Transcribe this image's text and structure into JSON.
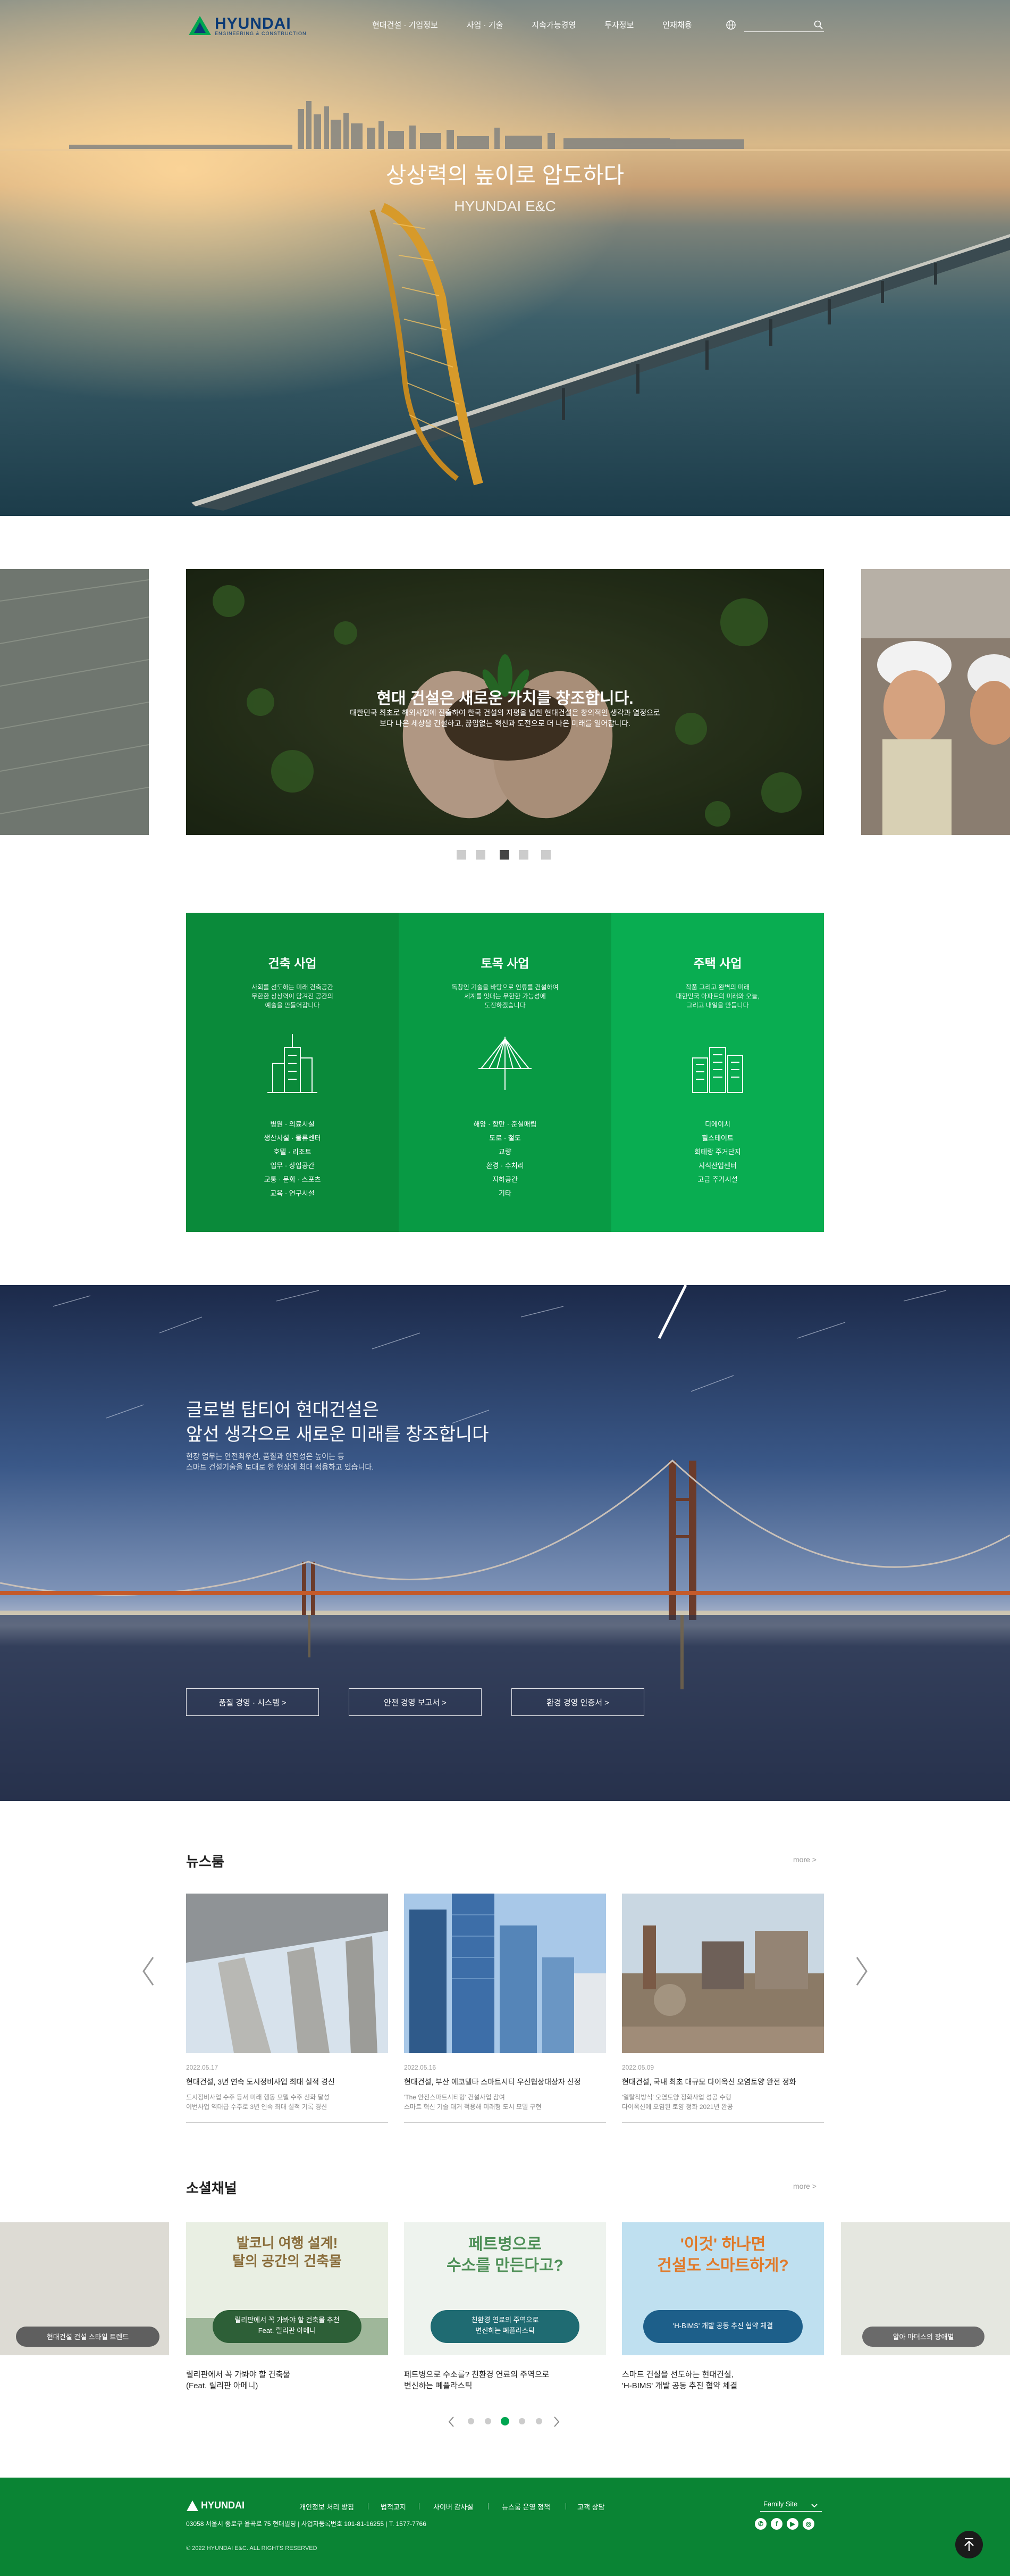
{
  "header": {
    "logo_text": "HYUNDAI",
    "logo_sub": "ENGINEERING & CONSTRUCTION",
    "nav": [
      "현대건설 · 기업정보",
      "사업 · 기술",
      "지속가능경영",
      "투자정보",
      "인재채용"
    ],
    "search_placeholder": ""
  },
  "hero": {
    "title": "상상력의 높이로 압도하다",
    "subtitle": "HYUNDAI E&C"
  },
  "carousel": {
    "title": "현대 건설은 새로운 가치를 창조합니다.",
    "desc": "대한민국 최초로 해외사업에 진출하여 한국 건설의 지평을 넓힌 현대건설은 창의적인 생각과 열정으로\n보다 나은 세상을 건설하고, 끊임없는 혁신과 도전으로 더 나은 미래를 열어갑니다.",
    "dots": 5,
    "active_dot": 3
  },
  "business": [
    {
      "title": "건축 사업",
      "desc": "사회를 선도하는 미래 건축공간\n무한한 상상력이 담겨진 공간의\n예술을 만들어갑니다",
      "items": [
        "병원 · 의료시설",
        "생산시설 · 물류센터",
        "호텔 · 리조트",
        "업무 · 상업공간",
        "교통 · 문화 · 스포츠",
        "교육 · 연구시설"
      ],
      "color": "#0a8a3a"
    },
    {
      "title": "토목 사업",
      "desc": "독창인 기술을 바탕으로 인류를 건설하여\n세계를 잇대는 무한한 가능성에\n도전하겠습니다",
      "items": [
        "해양 · 항만 · 준설매립",
        "도로 · 철도",
        "교량",
        "환경 · 수처리",
        "지하공간",
        "기타"
      ],
      "color": "#089a44"
    },
    {
      "title": "주택 사업",
      "desc": "작품 그리고 완벽의 미래\n대한민국 아파트의 미래와 오늘,\n그리고 내일을 만듭니다",
      "items": [
        "디에이치",
        "힐스테이트",
        "회테랑 주거단지",
        "지식산업센터",
        "고급 주거시설"
      ],
      "color": "#09ad51"
    }
  ],
  "global": {
    "title": "글로벌 탑티어 현대건설은\n앞선 생각으로 새로운 미래를 창조합니다",
    "desc": "현장 업무는 안전최우선, 품질과 안전성은 높이는 등\n스마트 건설기술을 토대로 한 현장에 최대 적용하고 있습니다.",
    "buttons": [
      "품질 경영 · 시스템 >",
      "안전 경영 보고서 >",
      "환경 경영 인증서 >"
    ]
  },
  "newsroom": {
    "title": "뉴스룸",
    "more": "more >",
    "items": [
      {
        "date": "2022.05.17",
        "title": "현대건설, 3년 연속 도시정비사업 최대 실적 경신",
        "summary": "도시정비사업 수주 등서 미래 행동 모델 수주 신화 달성\n이번사업 역대급 수주로 3년 연속 최대 실적 기록 경신"
      },
      {
        "date": "2022.05.16",
        "title": "현대건설, 부산 에코델타 스마트시티 우선협상대상자 선정",
        "summary": "'The 안전스마트시티형' 건설사업 참여\n스마트 혁신 기술 대거 적용해 미래형 도시 모델 구현"
      },
      {
        "date": "2022.05.09",
        "title": "현대건설, 국내 최초 대규모 다이옥신 오염토양 완전 정화",
        "summary": "'열탈착방식' 오염토양 정화사업 성공 수행\n다이옥신에 오염된 토양 정화 2021년 완공"
      }
    ]
  },
  "social": {
    "title": "소셜채널",
    "more": "more >",
    "cards": [
      {
        "img_headline": "발코니 여행 설계!\n탈의 공간의 건축물",
        "img_pill": "릴리판에서 꼭 가봐야 할 건축물 추천\nFeat. 릴리판 아메니",
        "caption": "릴리판에서 꼭 가봐야 할 건축물\n(Feat. 릴리판 아메니)"
      },
      {
        "img_headline": "페트병으로\n수소를 만든다고?",
        "img_pill": "친환경 연료의 주역으로\n변신하는 폐플라스틱",
        "caption": "페트병으로 수소를? 친환경 연료의 주역으로\n변신하는 폐플라스틱"
      },
      {
        "img_headline": "'이것' 하나면\n건설도 스마트하게?",
        "img_pill": "'H-BIMS' 개발 공동 추진 협약 체결",
        "caption": "스마트 건설을 선도하는 현대건설,\n'H-BIMS' 개발 공동 추진 협약 체결"
      }
    ],
    "side_left_pill": "현대건설 건설 스타일 트렌드",
    "side_right_pill": "알아 마더스의 장애별",
    "dots": 5,
    "active_dot": 3
  },
  "footer": {
    "logo_text": "HYUNDAI",
    "links": [
      "개인정보 처리 방침",
      "법적고지",
      "사이버 감사실",
      "뉴스룸 운영 정책",
      "고객 상담"
    ],
    "address": "03058 서울시 종로구 율곡로 75 현대빌딩  |  사업자등록번호 101-81-16255  |  T. 1577-7766",
    "copyright": "© 2022 HYUNDAI E&C. ALL RIGHTS RESERVED",
    "family_site": "Family Site",
    "sns": [
      "talk-icon",
      "facebook-icon",
      "youtube-icon",
      "instagram-icon"
    ]
  }
}
